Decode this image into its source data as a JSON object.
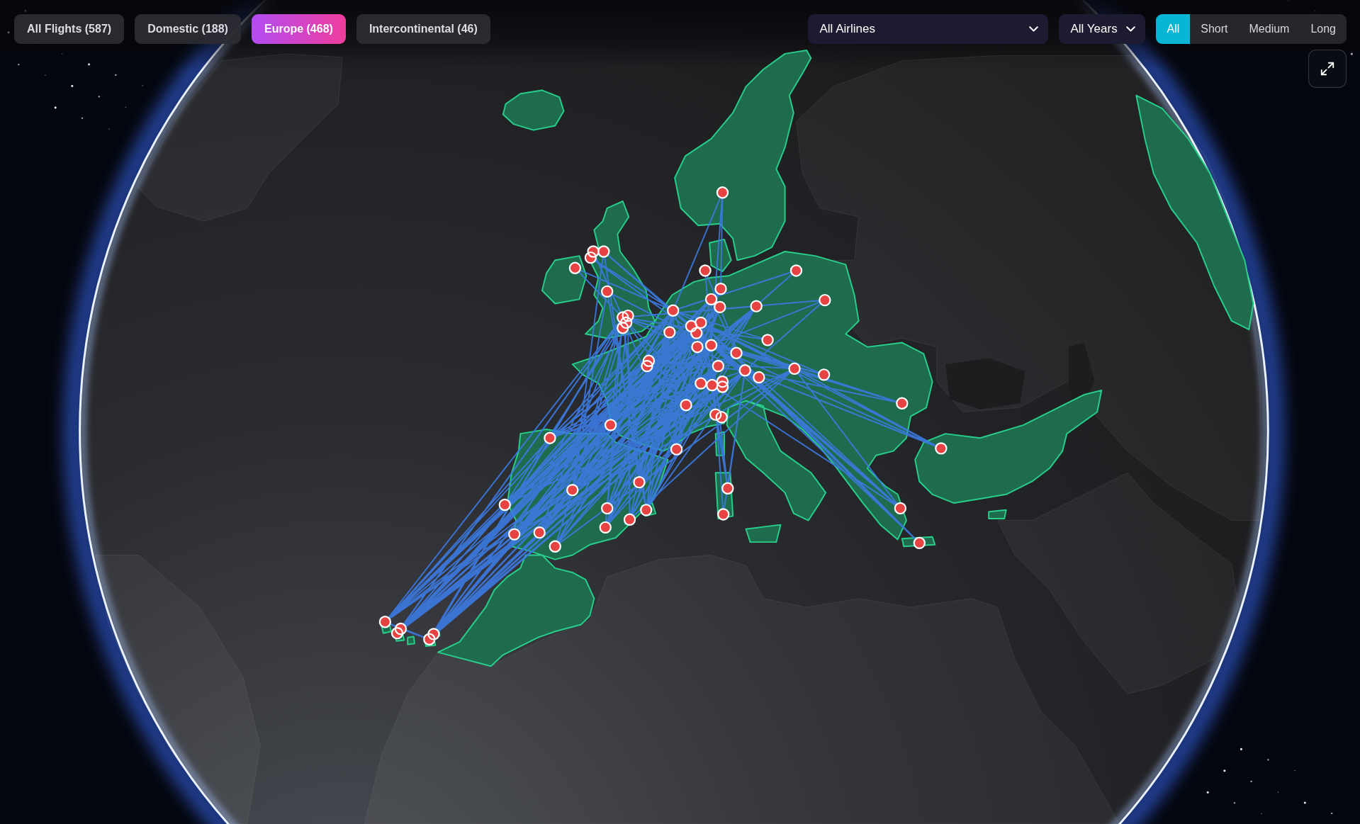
{
  "category_tabs": [
    {
      "label": "All Flights (587)",
      "selected": false
    },
    {
      "label": "Domestic (188)",
      "selected": false
    },
    {
      "label": "Europe (468)",
      "selected": true
    },
    {
      "label": "Intercontinental (46)",
      "selected": false
    }
  ],
  "airline_filter": {
    "value": "All Airlines"
  },
  "year_filter": {
    "value": "All Years"
  },
  "distance_tabs": [
    {
      "label": "All",
      "selected": true
    },
    {
      "label": "Short",
      "selected": false
    },
    {
      "label": "Medium",
      "selected": false
    },
    {
      "label": "Long",
      "selected": false
    }
  ]
}
